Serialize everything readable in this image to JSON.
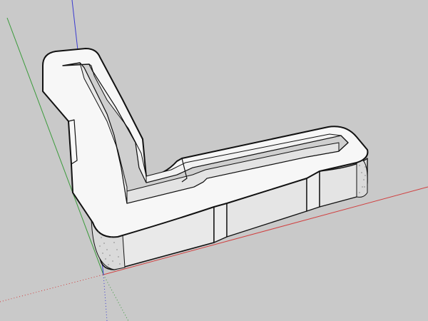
{
  "viewport": {
    "background_color": "#c9c9c9",
    "model": {
      "kind": "L-shaped bracket with inner slot",
      "face_color_top": "#f7f7f7",
      "face_color_side": "#e6e6e6",
      "face_color_inner_side": "#d8d8d8",
      "edge_color": "#111111"
    },
    "axes": {
      "red_axis_color": "#d04040",
      "green_axis_color": "#3a9a3a",
      "blue_axis_color": "#3a3ad0"
    }
  }
}
